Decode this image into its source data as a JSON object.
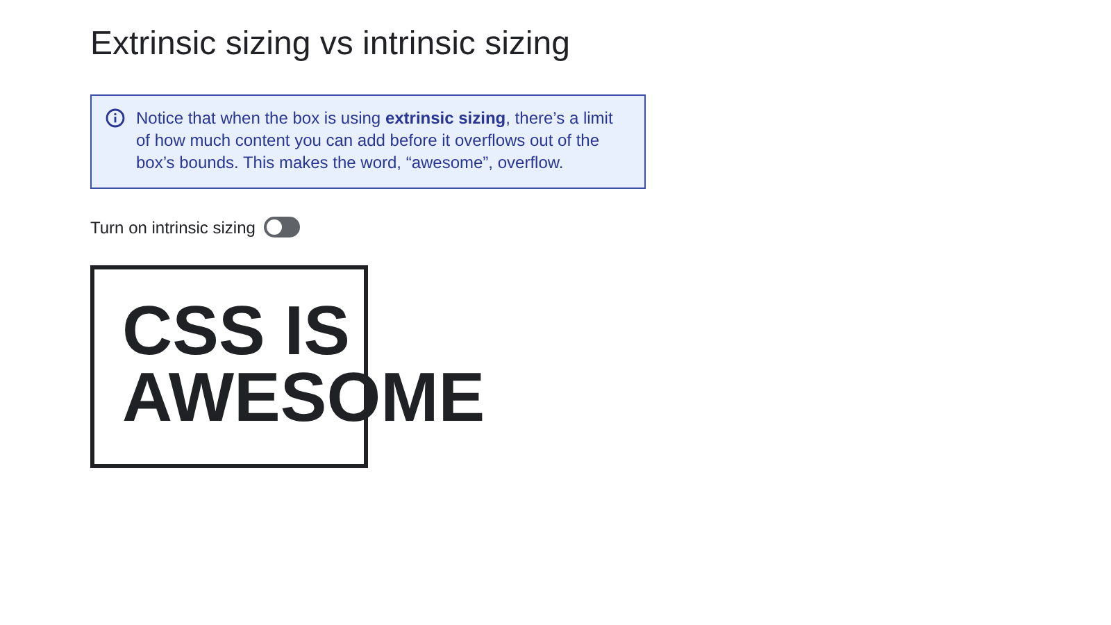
{
  "heading": "Extrinsic sizing vs intrinsic sizing",
  "notice": {
    "text": "Notice that when the box is using **extrinsic sizing**, there’s a limit of how much content you can add before it overflows out of the box’s bounds. This makes the word, “awesome”, overflow."
  },
  "toggle": {
    "label": "Turn on intrinsic sizing",
    "on": false
  },
  "demo_box": {
    "text": "CSS IS AWESOME"
  }
}
